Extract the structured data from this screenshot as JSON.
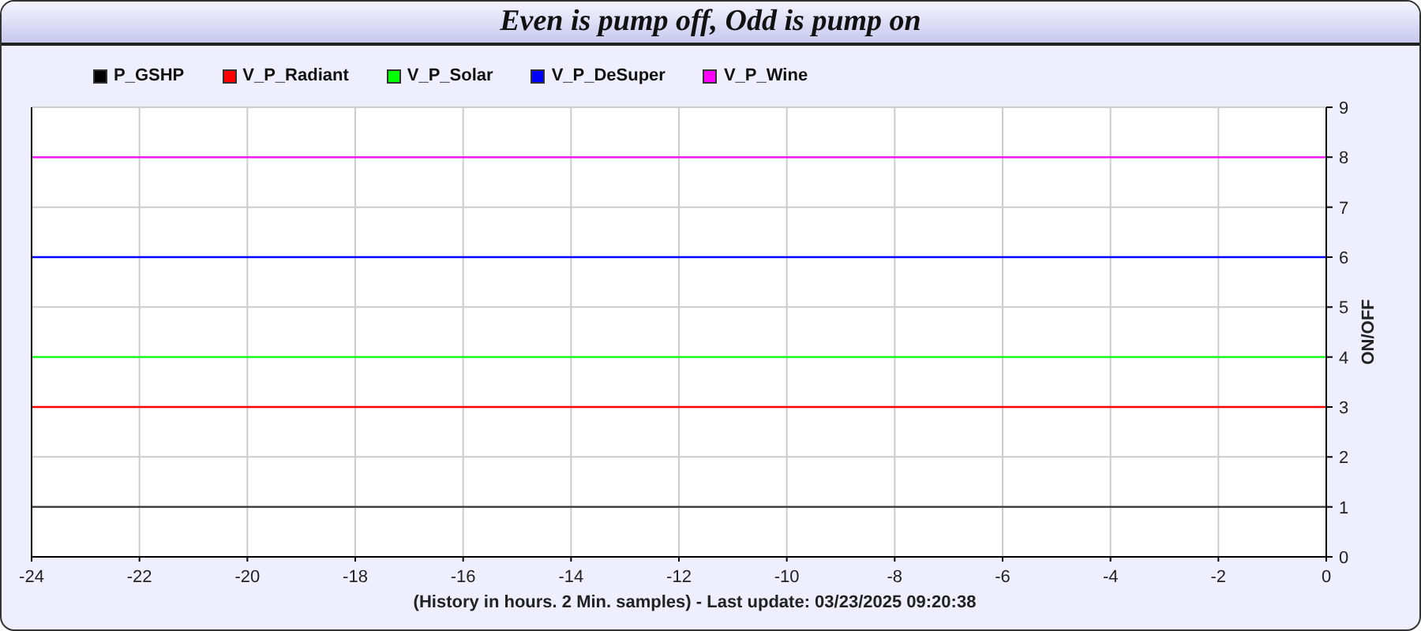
{
  "window": {
    "title": "Even is pump off, Odd is pump on"
  },
  "chart": {
    "chart_data": {
      "type": "line",
      "xlabel": "(History in hours. 2 Min. samples) - Last update: 03/23/2025 09:20:38",
      "ylabel": "ON/OFF",
      "x": [
        -24,
        0
      ],
      "series": [
        {
          "name": "P_GSHP",
          "color": "#000000",
          "values": [
            1,
            1
          ]
        },
        {
          "name": "V_P_Radiant",
          "color": "#ff0000",
          "values": [
            3,
            3
          ]
        },
        {
          "name": "V_P_Solar",
          "color": "#00ff00",
          "values": [
            4,
            4
          ]
        },
        {
          "name": "V_P_DeSuper",
          "color": "#0000ff",
          "values": [
            6,
            6
          ]
        },
        {
          "name": "V_P_Wine",
          "color": "#ff00ff",
          "values": [
            8,
            8
          ]
        }
      ],
      "xlim": [
        -24,
        0
      ],
      "ylim": [
        0,
        9
      ],
      "xticks": [
        -24,
        -22,
        -20,
        -18,
        -16,
        -14,
        -12,
        -10,
        -8,
        -6,
        -4,
        -2,
        0
      ],
      "yticks": [
        0,
        1,
        2,
        3,
        4,
        5,
        6,
        7,
        8,
        9
      ],
      "grid": true
    }
  }
}
